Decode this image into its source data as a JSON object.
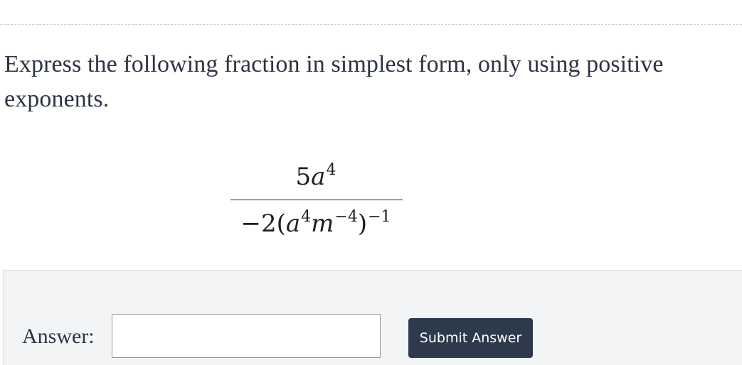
{
  "question": {
    "text": "Express the following fraction in simplest form, only using positive exponents."
  },
  "expression": {
    "numerator": {
      "coefficient": "5",
      "variable": "a",
      "exponent": "4"
    },
    "denominator": {
      "prefix": "−2(",
      "var1": "a",
      "exp1": "4",
      "var2": "m",
      "exp2": "−4",
      "suffix": ")",
      "outer_exp": "−1"
    }
  },
  "answer": {
    "label": "Answer:",
    "value": "",
    "placeholder": ""
  },
  "submit": {
    "label": "Submit Answer"
  },
  "colors": {
    "button_background": "#2c3a4b",
    "panel_background": "#f3f4f6",
    "text": "#2e3444"
  }
}
